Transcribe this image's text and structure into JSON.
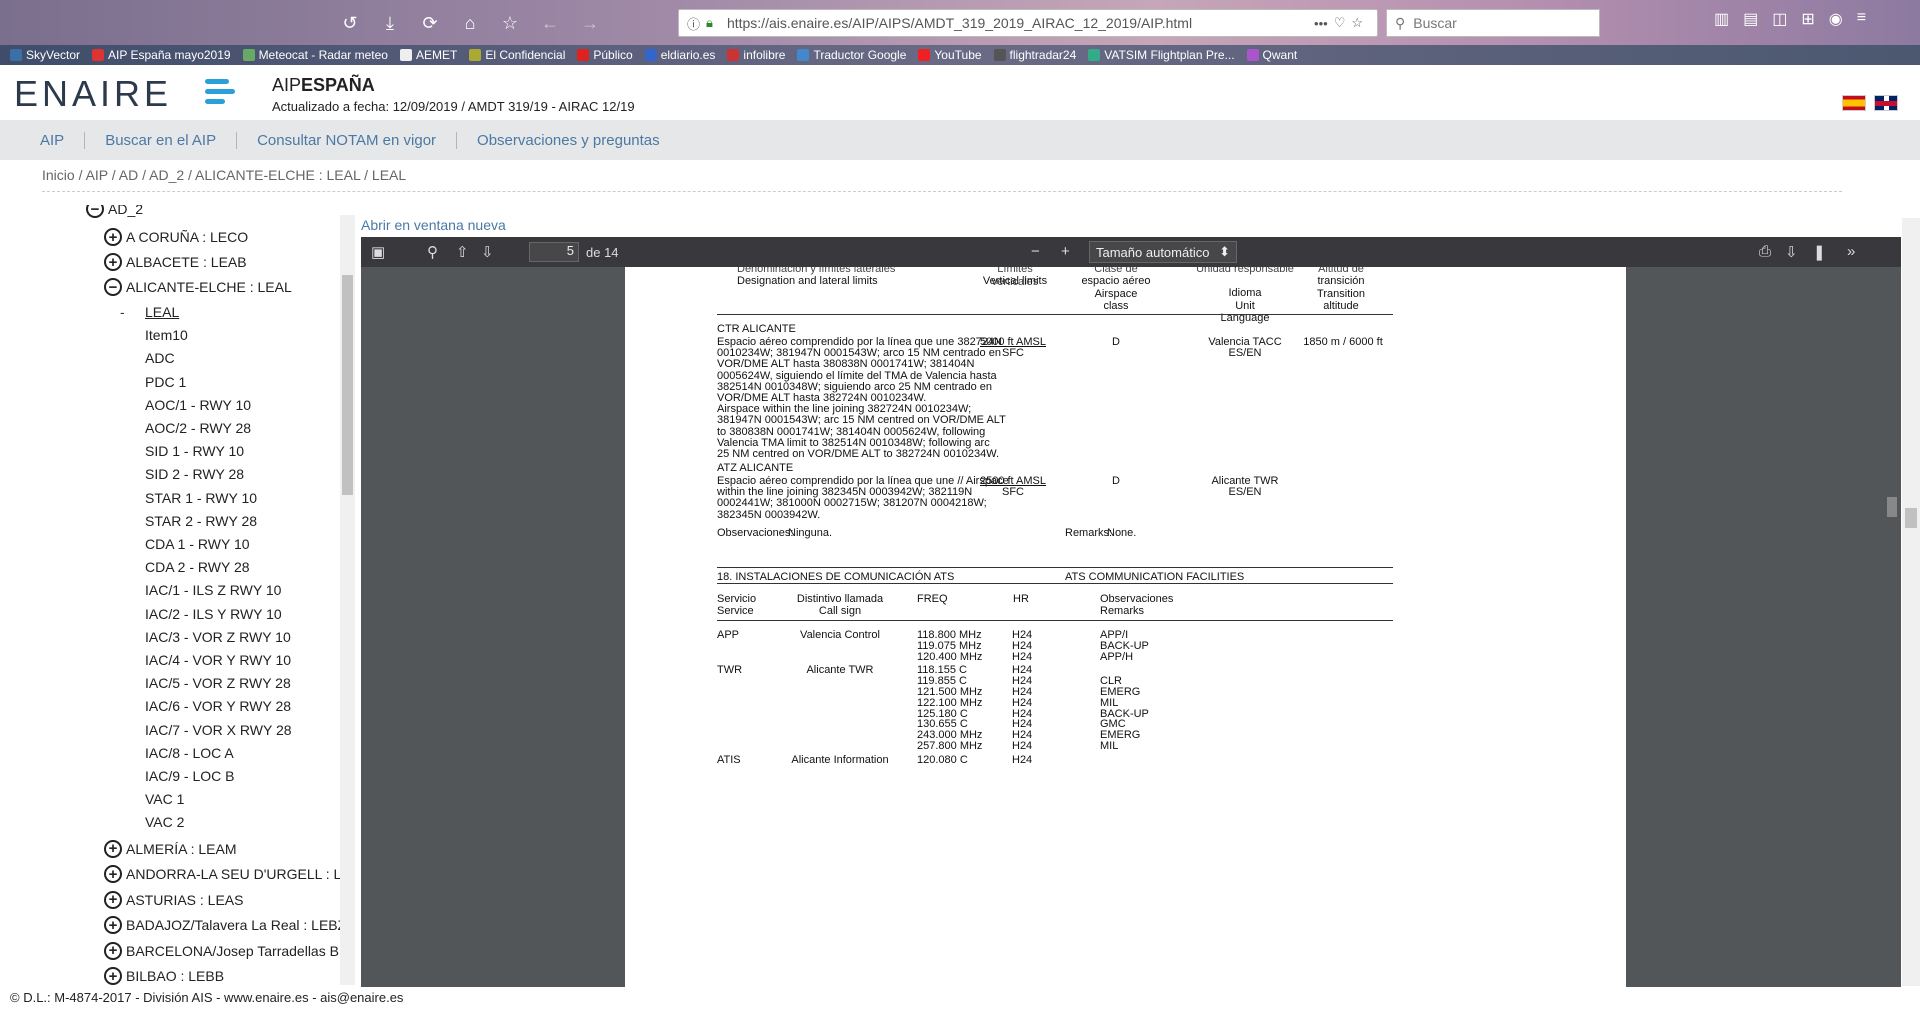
{
  "browser": {
    "url": "https://ais.enaire.es/AIP/AIPS/AMDT_319_2019_AIRAC_12_2019/AIP.html",
    "search_placeholder": "Buscar",
    "bookmarks": [
      "SkyVector",
      "AIP España mayo2019",
      "Meteocat - Radar meteo",
      "AEMET",
      "El Confidencial",
      "Público",
      "eldiario.es",
      "infolibre",
      "Traductor Google",
      "YouTube",
      "flightradar24",
      "VATSIM Flightplan Pre...",
      "Qwant"
    ]
  },
  "header": {
    "logo": "ENAIRE",
    "title_prefix": "AIP",
    "title_bold": "ESPAÑA",
    "updated": "Actualizado a fecha: 12/09/2019 / AMDT 319/19 - AIRAC 12/19"
  },
  "nav": [
    "AIP",
    "Buscar en el AIP",
    "Consultar NOTAM en vigor",
    "Observaciones y preguntas"
  ],
  "breadcrumb": "Inicio / AIP / AD / AD_2 / ALICANTE-ELCHE : LEAL / LEAL",
  "tree": {
    "top_partial": "AD_2",
    "nodes_before": [
      "A CORUÑA : LECO",
      "ALBACETE : LEAB"
    ],
    "expanded": "ALICANTE-ELCHE : LEAL",
    "leaves": [
      "LEAL",
      "Item10",
      "ADC",
      "PDC 1",
      "AOC/1 - RWY 10",
      "AOC/2 - RWY 28",
      "SID 1 - RWY 10",
      "SID 2 - RWY 28",
      "STAR 1 - RWY 10",
      "STAR 2 - RWY 28",
      "CDA 1 - RWY 10",
      "CDA 2 - RWY 28",
      "IAC/1 - ILS Z RWY 10",
      "IAC/2 - ILS Y RWY 10",
      "IAC/3 - VOR Z RWY 10",
      "IAC/4 - VOR Y RWY 10",
      "IAC/5 - VOR Z RWY 28",
      "IAC/6 - VOR Y RWY 28",
      "IAC/7 - VOR X RWY 28",
      "IAC/8 - LOC A",
      "IAC/9 - LOC B",
      "VAC 1",
      "VAC 2"
    ],
    "nodes_after": [
      "ALMERÍA : LEAM",
      "ANDORRA-LA SEU D'URGELL : LE",
      "ASTURIAS : LEAS",
      "BADAJOZ/Talavera La Real : LEBZ",
      "BARCELONA/Josep Tarradellas B",
      "BILBAO : LEBB"
    ]
  },
  "viewer": {
    "open_new": "Abrir en ventana nueva",
    "page": "5",
    "of": "de 14",
    "zoom": "Tamaño automático"
  },
  "doc": {
    "h_partial1": "Denominación y límites laterales",
    "h1": "Designation and lateral limits",
    "h_partial2": "Límites verticales",
    "h2": "Vertical limits",
    "h_partial3": "Clase de",
    "h3": [
      "espacio aéreo",
      "Airspace",
      "class"
    ],
    "h_partial4": "Unidad responsable",
    "h4": [
      "Idioma",
      "Unit",
      "Language"
    ],
    "h_partial5": "Altitud de",
    "h5": [
      "transición",
      "Transition",
      "altitude"
    ],
    "ctr_title": "CTR ALICANTE",
    "ctr_text": [
      "Espacio aéreo comprendido por la línea que une 382724N",
      "0010234W; 381947N 0001543W; arco 15 NM centrado en",
      "VOR/DME ALT hasta 380838N 0001741W; 381404N",
      "0005624W, siguiendo el límite del TMA de Valencia hasta",
      "382514N 0010348W; siguiendo arco 25 NM centrado en",
      "VOR/DME ALT hasta 382724N 0010234W.",
      "Airspace within the line joining 382724N 0010234W;",
      "381947N 0001543W; arc 15 NM centred on VOR/DME ALT",
      "to 380838N 0001741W; 381404N 0005624W, following",
      "Valencia TMA limit to 382514N 0010348W; following arc",
      "25 NM centred on VOR/DME ALT to 382724N 0010234W."
    ],
    "ctr_upper": "5000 ft AMSL",
    "ctr_lower": "SFC",
    "ctr_class": "D",
    "ctr_unit": "Valencia TACC",
    "ctr_lang": "ES/EN",
    "ctr_trans": "1850 m / 6000 ft",
    "atz_title": "ATZ ALICANTE",
    "atz_text": [
      "Espacio aéreo comprendido por la línea que une // Airspace",
      "within the line joining 382345N 0003942W; 382119N",
      "0002441W; 381000N 0002715W; 381207N 0004218W;",
      "382345N 0003942W."
    ],
    "atz_upper": "2500 ft AMSL",
    "atz_lower": "SFC",
    "atz_class": "D",
    "atz_unit": "Alicante TWR",
    "atz_lang": "ES/EN",
    "obs_label": "Observaciones:",
    "obs_value": "Ninguna.",
    "rem_label": "Remarks:",
    "rem_value": "None.",
    "sec18_es": "18. INSTALACIONES DE COMUNICACIÓN ATS",
    "sec18_en": "ATS COMMUNICATION FACILITIES",
    "col_service": [
      "Servicio",
      "Service"
    ],
    "col_callsign": [
      "Distintivo llamada",
      "Call sign"
    ],
    "col_freq": "FREQ",
    "col_hr": "HR",
    "col_remarks": [
      "Observaciones",
      "Remarks"
    ],
    "rows": [
      {
        "service": "APP",
        "callsign": "Valencia Control",
        "freqs": [
          "118.800 MHz",
          "119.075 MHz",
          "120.400 MHz"
        ],
        "hrs": [
          "H24",
          "H24",
          "H24"
        ],
        "remarks": [
          "APP/I",
          "BACK-UP",
          "APP/H"
        ]
      },
      {
        "service": "TWR",
        "callsign": "Alicante TWR",
        "freqs": [
          "118.155 C",
          "119.855 C",
          "121.500 MHz",
          "122.100 MHz",
          "125.180 C",
          "130.655 C",
          "243.000 MHz",
          "257.800 MHz"
        ],
        "hrs": [
          "H24",
          "H24",
          "H24",
          "H24",
          "H24",
          "H24",
          "H24",
          "H24"
        ],
        "remarks": [
          "",
          "CLR",
          "EMERG",
          "MIL",
          "BACK-UP",
          "GMC",
          "EMERG",
          "MIL"
        ]
      },
      {
        "service": "ATIS",
        "callsign": "Alicante Information",
        "freqs": [
          "120.080 C"
        ],
        "hrs": [
          "H24"
        ],
        "remarks": [
          ""
        ]
      }
    ]
  },
  "footer": "© D.L.: M-4874-2017 - División AIS - www.enaire.es - ais@enaire.es",
  "colors": {
    "link": "#4a79a5",
    "nav_bg": "#e6e7e8",
    "viewer_bg": "#525659",
    "viewer_toolbar": "#38383d"
  }
}
